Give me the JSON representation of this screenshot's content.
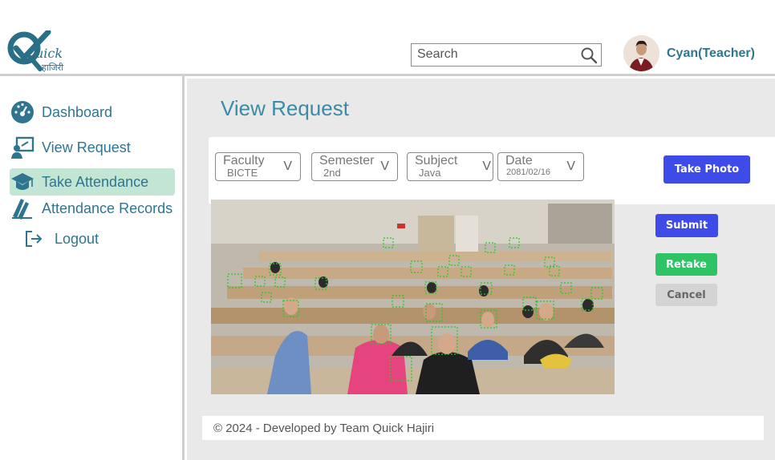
{
  "brand": {
    "logo_text": "uick",
    "logo_subtext": "हाजिरी"
  },
  "header": {
    "search_placeholder": "Search",
    "search_icon": "magnifier-icon",
    "user_name": "Cyan(Teacher)"
  },
  "sidebar": {
    "items": [
      {
        "label": "Dashboard",
        "icon": "gauge-icon"
      },
      {
        "label": "View Request",
        "icon": "user-screen-icon"
      },
      {
        "label": "Take Attendance",
        "icon": "graduation-cap-icon",
        "active": true
      },
      {
        "label": "Attendance Records",
        "icon": "books-icon"
      },
      {
        "label": "Logout",
        "icon": "logout-icon"
      }
    ]
  },
  "main": {
    "title": "View Request",
    "filters": {
      "faculty": {
        "label": "Faculty",
        "value": "BICTE"
      },
      "semester": {
        "label": "Semester",
        "value": "2nd"
      },
      "subject": {
        "label": "Subject",
        "value": "Java"
      },
      "date": {
        "label": "Date",
        "value": "2081/02/16"
      },
      "chevron": "V"
    },
    "buttons": {
      "take_photo": "Take Photo",
      "submit": "Submit",
      "retake": "Retake",
      "cancel": "Cancel"
    }
  },
  "footer": {
    "text": "© 2024 - Developed by Team Quick Hajiri"
  },
  "colors": {
    "primary_text": "#2f7590",
    "accent_blue": "#3f4be8",
    "success_green": "#2ec465",
    "active_nav": "#c3e5d3",
    "main_bg": "#e9e9e9",
    "face_box": "#22cc22"
  }
}
